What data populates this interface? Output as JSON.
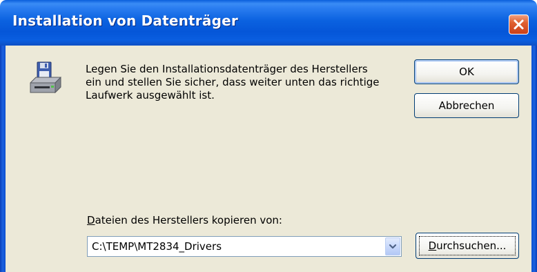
{
  "window": {
    "title": "Installation von Datenträger"
  },
  "icons": {
    "drive": "floppy-drive-icon",
    "close": "close-icon",
    "dropdown": "chevron-down-icon"
  },
  "message": {
    "text": "Legen Sie den Installationsdatenträger des Herstellers\nein und stellen Sie sicher, dass weiter unten das richtige\nLaufwerk ausgewählt ist."
  },
  "buttons": {
    "ok": "OK",
    "cancel": "Abbrechen",
    "browse_mnemonic": "D",
    "browse_rest": "urchsuchen..."
  },
  "source": {
    "label_mnemonic": "D",
    "label_rest": "ateien des Herstellers kopieren von:",
    "path": "C:\\TEMP\\MT2834_Drivers"
  },
  "colors": {
    "titlebar": "#0556d8",
    "close_button": "#e06030",
    "dialog_background": "#ece9d8",
    "button_border": "#003c74"
  }
}
